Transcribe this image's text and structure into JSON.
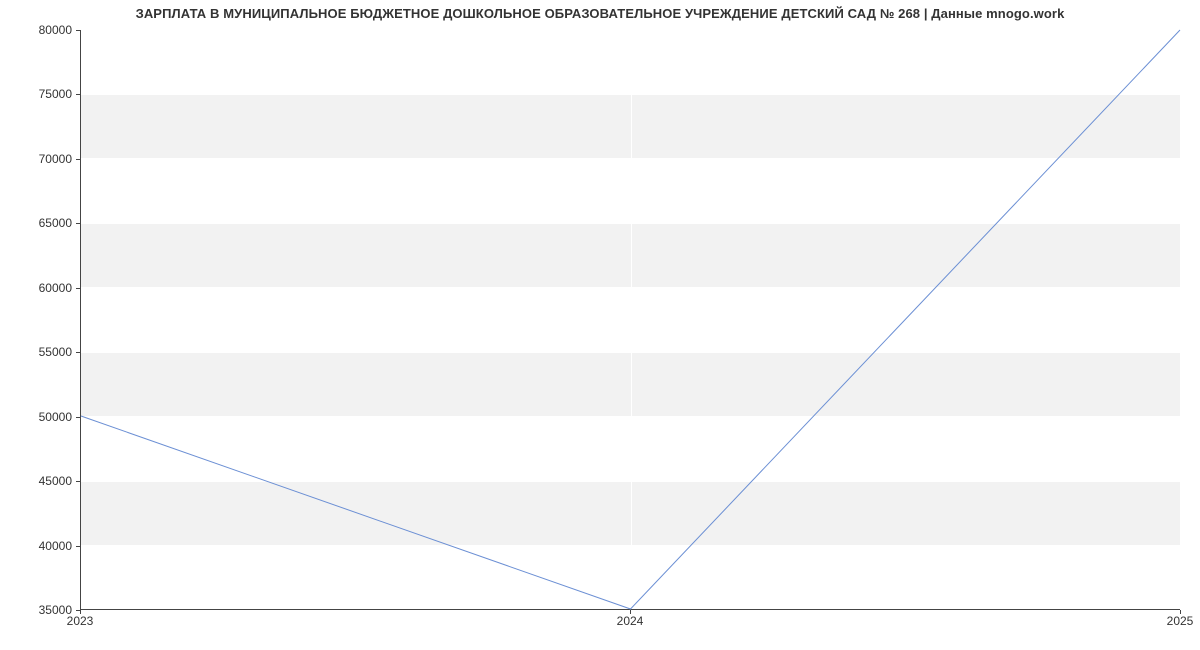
{
  "chart_data": {
    "type": "line",
    "title": "ЗАРПЛАТА В МУНИЦИПАЛЬНОЕ БЮДЖЕТНОЕ ДОШКОЛЬНОЕ ОБРАЗОВАТЕЛЬНОЕ УЧРЕЖДЕНИЕ ДЕТСКИЙ САД № 268 | Данные mnogo.work",
    "xlabel": "",
    "ylabel": "",
    "x_categories": [
      "2023",
      "2024",
      "2025"
    ],
    "y_ticks": [
      35000,
      40000,
      45000,
      50000,
      55000,
      60000,
      65000,
      70000,
      75000,
      80000
    ],
    "ylim": [
      35000,
      80000
    ],
    "series": [
      {
        "name": "salary",
        "color": "#6b8fd4",
        "x": [
          "2023",
          "2024",
          "2025"
        ],
        "y": [
          50000,
          35000,
          80000
        ]
      }
    ]
  }
}
